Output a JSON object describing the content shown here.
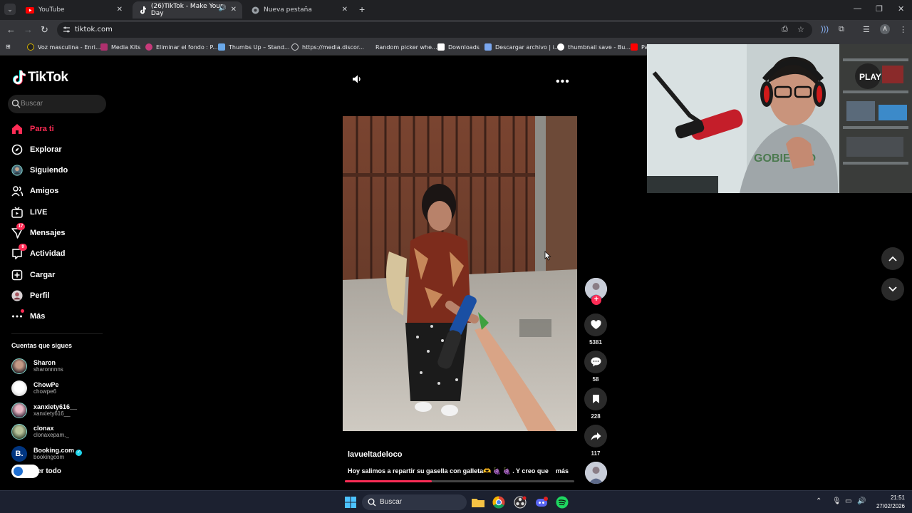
{
  "browser": {
    "tabs": [
      {
        "title": "YouTube",
        "icon": "youtube-icon"
      },
      {
        "title": "(26)TikTok - Make Your Day",
        "icon": "tiktok-icon",
        "active": true
      },
      {
        "title": "Nueva pestaña",
        "icon": "chrome-icon"
      }
    ],
    "url": "tiktok.com",
    "profile_initial": "A",
    "bookmarks": [
      "Voz masculina - Enri...",
      "Media Kits",
      "Eliminar el fondo : P...",
      "Thumbs Up – Stand...",
      "https://media.discor...",
      "Random picker whe...",
      "Downloads",
      "Descargar archivo | i...",
      "thumbnail save - Bu...",
      "Pa"
    ]
  },
  "tiktok": {
    "logo": "TikTok",
    "search_placeholder": "Buscar",
    "nav": [
      {
        "label": "Para ti",
        "icon": "home-icon",
        "active": true
      },
      {
        "label": "Explorar",
        "icon": "compass-icon"
      },
      {
        "label": "Siguiendo",
        "icon": "following-avatar-icon"
      },
      {
        "label": "Amigos",
        "icon": "friends-icon"
      },
      {
        "label": "LIVE",
        "icon": "live-icon"
      },
      {
        "label": "Mensajes",
        "icon": "messages-icon",
        "badge": "17"
      },
      {
        "label": "Actividad",
        "icon": "activity-icon",
        "badge": "9"
      },
      {
        "label": "Cargar",
        "icon": "upload-icon"
      },
      {
        "label": "Perfil",
        "icon": "profile-icon"
      },
      {
        "label": "Más",
        "icon": "more-icon"
      }
    ],
    "following_title": "Cuentas que sigues",
    "following": [
      {
        "name": "Sharon",
        "handle": "sharonnnns"
      },
      {
        "name": "ChowPe",
        "handle": "chowpe6"
      },
      {
        "name": "xanxiety616__",
        "handle": "xanxiety616__"
      },
      {
        "name": "clonax",
        "handle": "clonaxepam._"
      },
      {
        "name": "Booking.com",
        "handle": "bookingcom",
        "verified": true
      }
    ],
    "see_all": "Ver todo",
    "video": {
      "author": "lavueltadeloco",
      "caption": "Hoy salimos a repartir su gasella con galleta🫶 🍇 🍇 . Y creo que",
      "more": "más",
      "progress": 0.38,
      "likes": "5381",
      "comments": "58",
      "saves": "228",
      "shares": "117"
    }
  },
  "taskbar": {
    "search_placeholder": "Buscar",
    "time": "21:51",
    "date": "27/02/2026"
  },
  "colors": {
    "accent": "#fe2c55",
    "chrome_dark": "#202124",
    "chrome_toolbar": "#35363a",
    "taskbar": "#1c2130"
  }
}
